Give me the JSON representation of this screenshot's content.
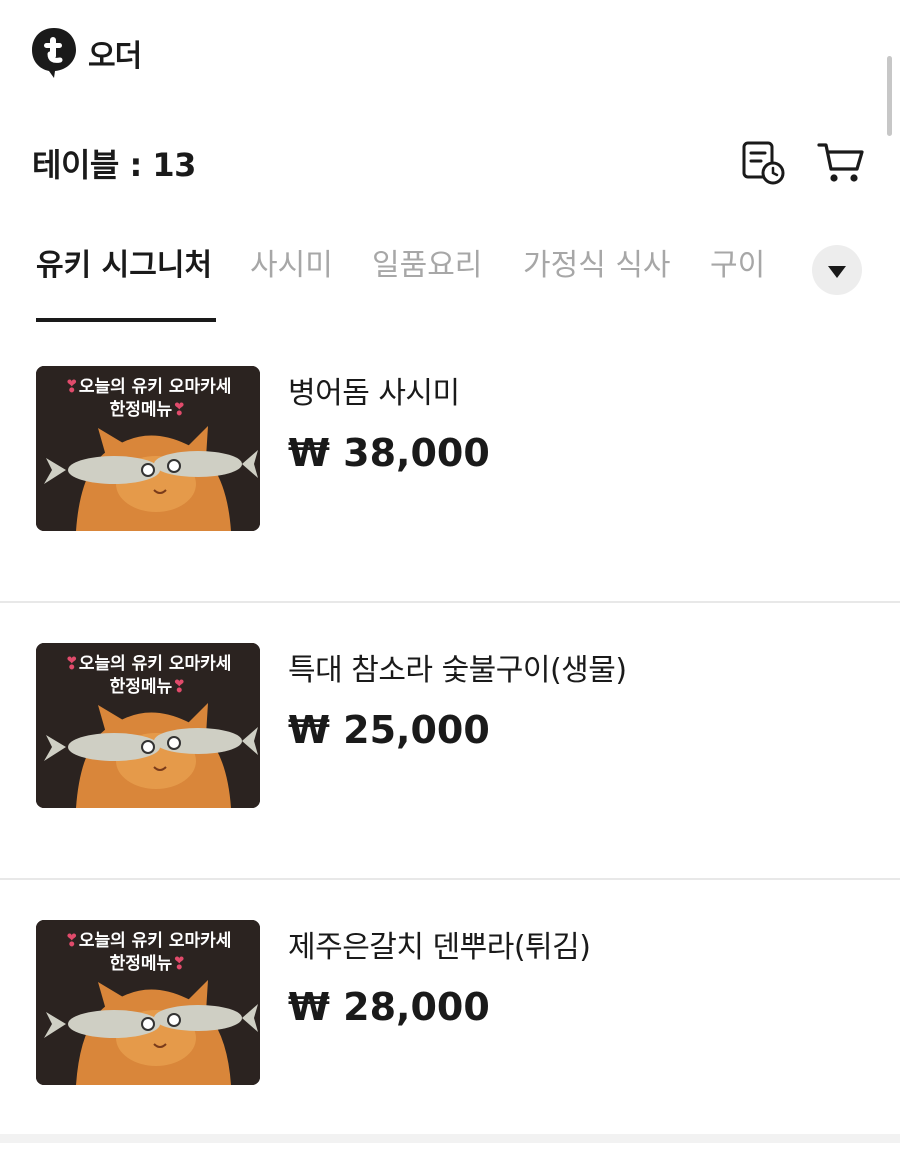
{
  "app": {
    "logo_icon": "brand-t-bubble-icon",
    "logo_text": "오더"
  },
  "header": {
    "table_label": "테이블 : 13",
    "order_history_icon": "receipt-clock-icon",
    "cart_icon": "cart-icon"
  },
  "tabs": [
    {
      "label": "유키 시그니처",
      "active": true
    },
    {
      "label": "사시미",
      "active": false
    },
    {
      "label": "일품요리",
      "active": false
    },
    {
      "label": "가정식 식사",
      "active": false
    },
    {
      "label": "구이",
      "active": false
    }
  ],
  "tabs_expand_icon": "chevron-down-icon",
  "thumbnail": {
    "heart": "❣",
    "line1": "오늘의 유키 오마카세",
    "line2": "한정메뉴"
  },
  "menu": [
    {
      "name": "병어돔 사시미",
      "price": "₩ 38,000"
    },
    {
      "name": "특대 참소라 숯불구이(생물)",
      "price": "₩ 25,000"
    },
    {
      "name": "제주은갈치 덴뿌라(튀김)",
      "price": "₩ 28,000"
    }
  ],
  "colors": {
    "text": "#1a1a1a",
    "inactive_tab": "#a7a7a7",
    "divider": "#e8e8e8",
    "thumb_bg": "#2b2320",
    "heart": "#e14b6b"
  }
}
